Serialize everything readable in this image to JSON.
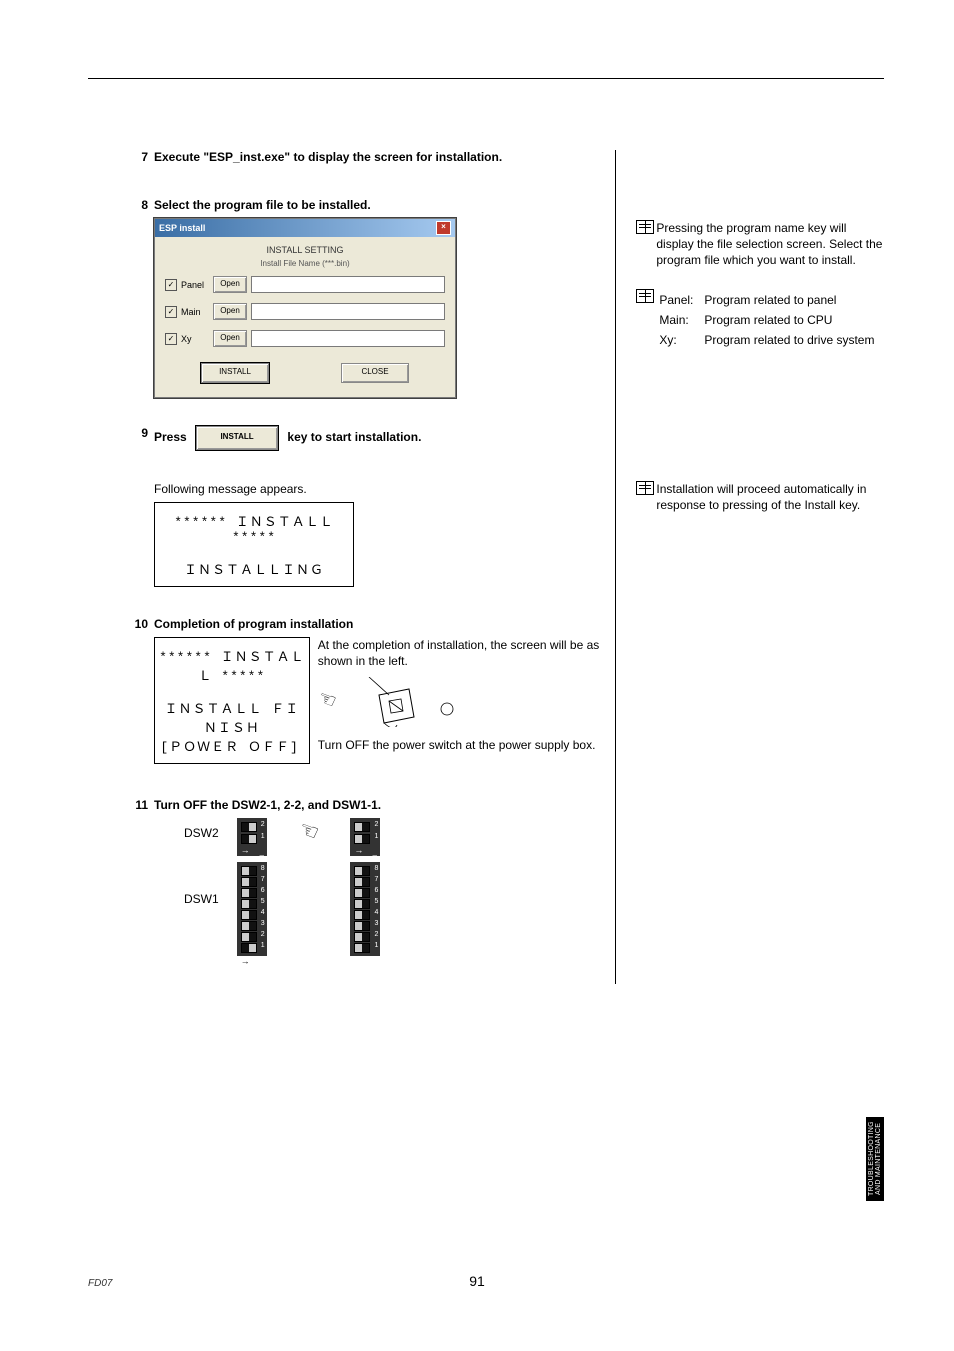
{
  "steps": {
    "s7": {
      "num": "7",
      "title": "Execute \"ESP_inst.exe\" to display the screen for installation."
    },
    "s8": {
      "num": "8",
      "title": "Select the program file to be installed."
    },
    "s9": {
      "num": "9",
      "press": "Press",
      "after": "key to start installation.",
      "following": "Following message appears.",
      "msg1": "****** ＩＮＳＴＡＬＬ *****",
      "msg2": "ＩＮＳＴＡＬＬＩＮＧ"
    },
    "s10": {
      "num": "10",
      "title": "Completion of program installation",
      "msg1": "****** ＩＮＳＴＡＬＬ *****",
      "msg2": "ＩＮＳＴＡＬＬ ＦＩＮＩＳＨ",
      "msg3": "[ＰＯＷＥＲ ＯＦＦ]",
      "right": "At the completion of installation, the screen will be as shown in the left.",
      "below": "Turn OFF the power switch at the power supply box."
    },
    "s11": {
      "num": "11",
      "title": "Turn OFF the DSW2-1, 2-2, and DSW1-1.",
      "lblDSW2": "DSW2",
      "lblDSW1": "DSW1"
    }
  },
  "dialog": {
    "title": "ESP install",
    "header": "INSTALL SETTING",
    "sub": "Install File Name (***.bin)",
    "rowPanel": "Panel",
    "rowMain": "Main",
    "rowXy": "Xy",
    "open": "Open",
    "install": "INSTALL",
    "close": "CLOSE"
  },
  "inline_install": "INSTALL",
  "notes": {
    "n1": "Pressing the program name key will display the file selection screen.  Select the program file which you want to install.",
    "n2_panel_k": "Panel:",
    "n2_panel_v": "Program related to panel",
    "n2_main_k": "Main:",
    "n2_main_v": "Program related to CPU",
    "n2_xy_k": "Xy:",
    "n2_xy_v": "Program related to drive system",
    "n3": "Installation will proceed automatically in response to pressing of the Install key."
  },
  "footer": {
    "page": "91",
    "fd": "FD07",
    "tab": "TROUBLESHOOTING AND MAINTENANCE"
  }
}
